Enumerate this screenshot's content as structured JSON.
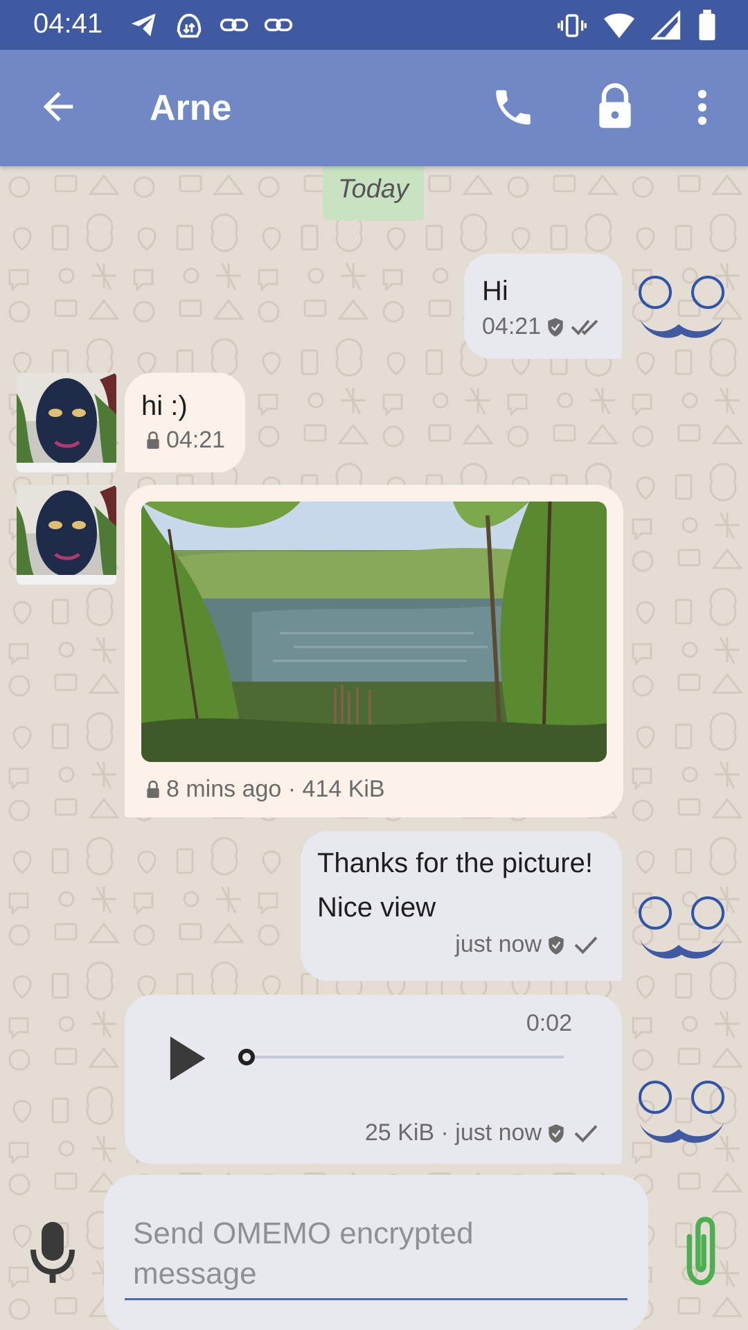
{
  "status_bar": {
    "time": "04:41",
    "left_icons": [
      "telegram-icon",
      "data-sync-icon",
      "link-icon",
      "link-icon"
    ],
    "right_icons": [
      "vibrate-icon",
      "wifi-icon",
      "signal-icon",
      "battery-icon"
    ]
  },
  "toolbar": {
    "title": "Arne",
    "actions": [
      "call-icon",
      "lock-icon",
      "more-icon"
    ]
  },
  "date_chip": "Today",
  "messages": [
    {
      "direction": "sent",
      "text": "Hi",
      "time": "04:21",
      "status": "read",
      "encryption": "verified"
    },
    {
      "direction": "received",
      "text": "hi :)",
      "time": "04:21",
      "encryption": "lock"
    },
    {
      "direction": "received",
      "type": "image",
      "meta": "8 mins ago · 414 KiB",
      "encryption": "lock"
    },
    {
      "direction": "sent",
      "line1": "Thanks for the picture!",
      "line2": "Nice view",
      "time": "just now",
      "status": "sent",
      "encryption": "verified"
    },
    {
      "direction": "sent",
      "type": "audio",
      "duration": "0:02",
      "meta": "25 KiB · just now",
      "progress": 0,
      "status": "sent",
      "encryption": "verified"
    }
  ],
  "composer": {
    "placeholder_line1": "Send OMEMO encrypted",
    "placeholder_line2": "message"
  },
  "colors": {
    "status_bar": "#3f5aa0",
    "toolbar": "#7088c4",
    "sent_bubble": "#e8e9ee",
    "received_bubble": "#fdf2ea",
    "accent": "#2f54a8",
    "attach_green": "#4caf50"
  }
}
